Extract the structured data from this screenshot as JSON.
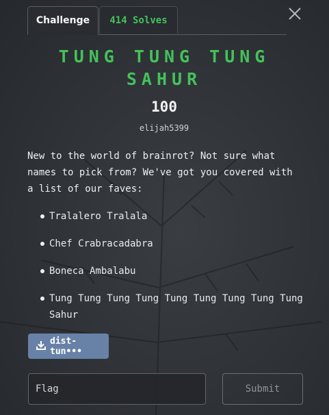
{
  "tabs": {
    "challenge": "Challenge",
    "solves": "414 Solves"
  },
  "challenge": {
    "title": "TUNG TUNG TUNG SAHUR",
    "points": "100",
    "author": "elijah5399",
    "description": "New to the world of brainrot? Not sure what names to pick from? We've got you covered with a list of our faves:",
    "names": [
      "Tralalero Tralala",
      "Chef Crabracadabra",
      "Boneca Ambalabu",
      "Tung Tung Tung Tung Tung Tung Tung Tung Tung Sahur"
    ],
    "file_label": "dist-tun•••"
  },
  "form": {
    "flag_placeholder": "Flag",
    "submit_label": "Submit"
  },
  "colors": {
    "accent_green": "#43c25a",
    "file_button": "#6882a7",
    "background": "#2b2e33"
  },
  "icons": {
    "close": "close-icon",
    "download": "download-icon"
  }
}
